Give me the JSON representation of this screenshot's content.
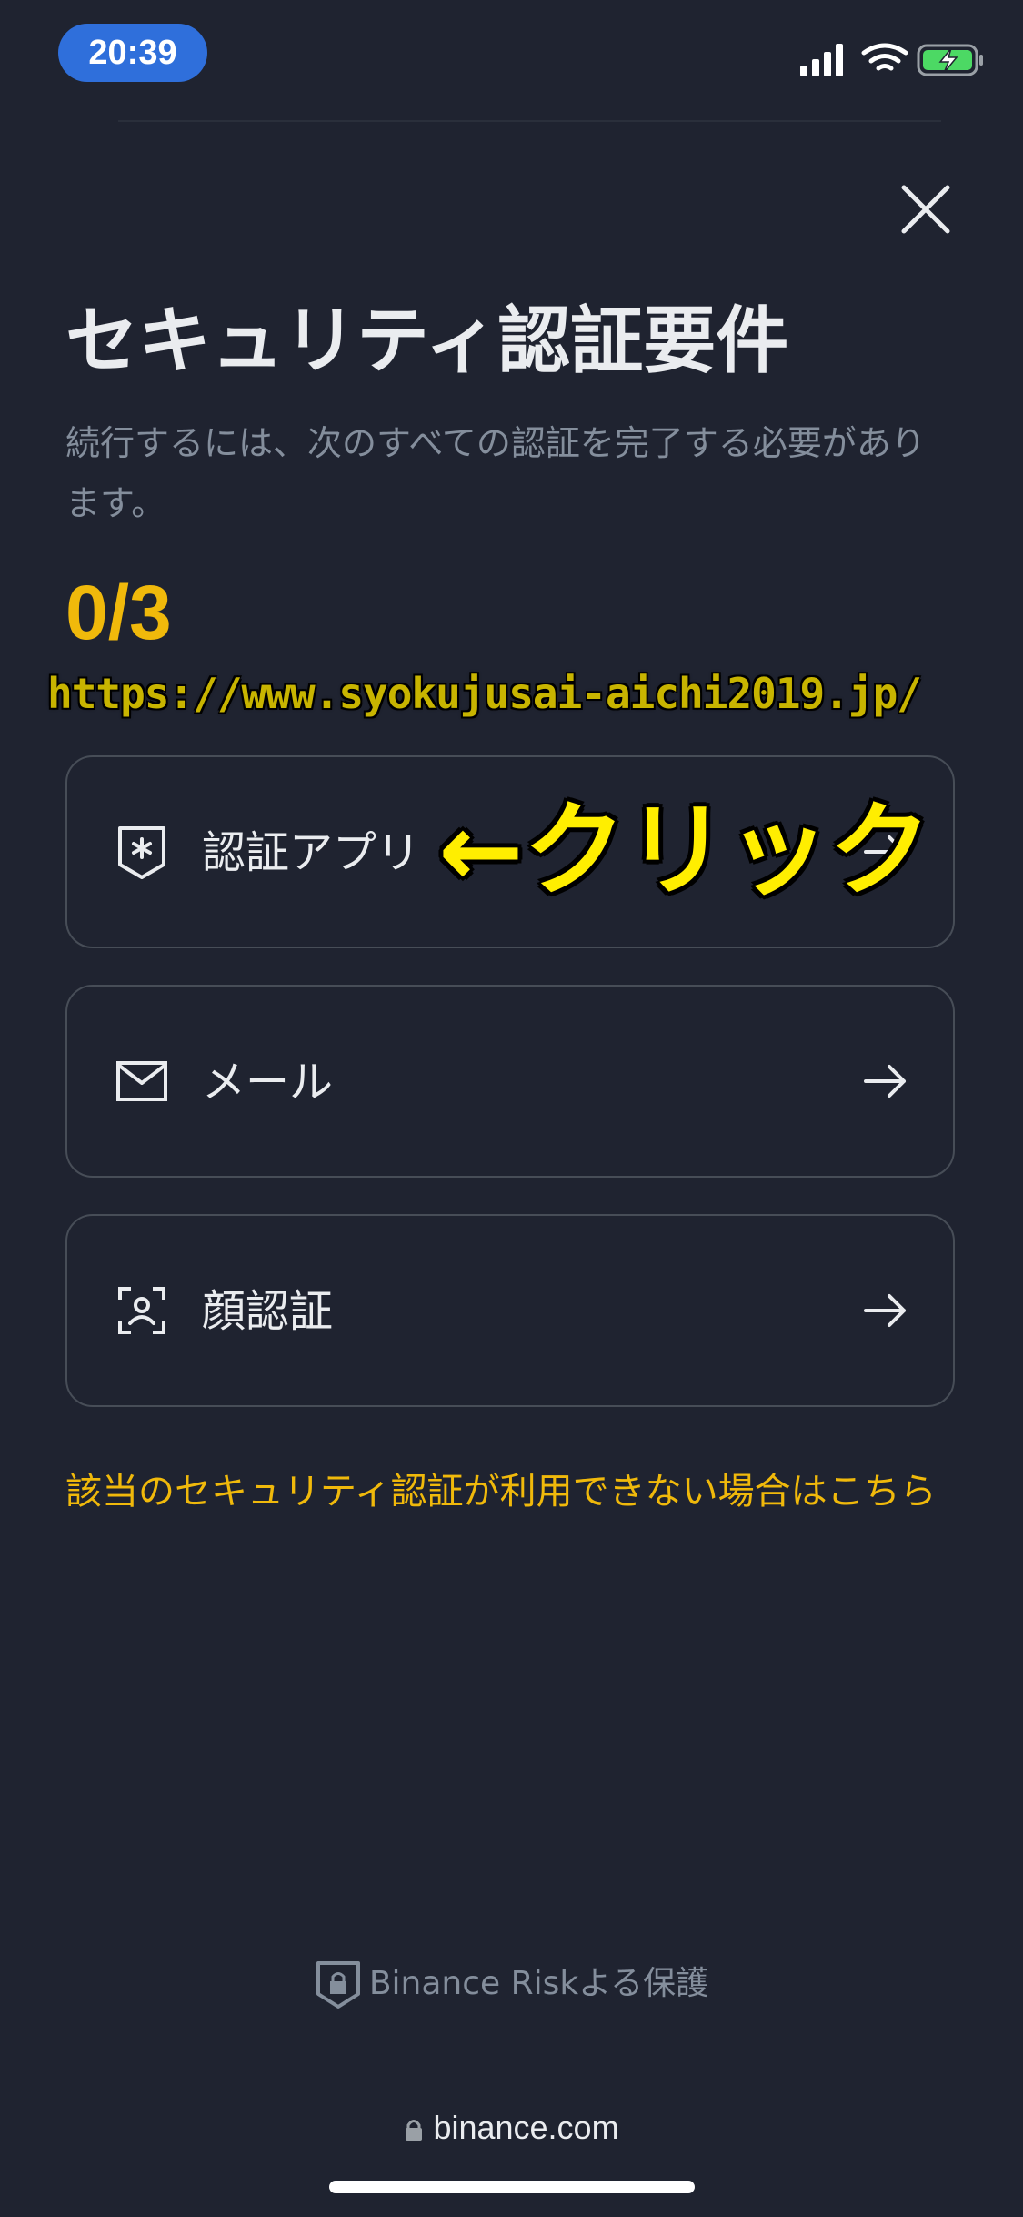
{
  "status_bar": {
    "time": "20:39"
  },
  "page": {
    "title": "セキュリティ認証要件",
    "subtitle": "続行するには、次のすべての認証を完了する必要があります。",
    "progress": "0/3"
  },
  "watermark": "https://www.syokujusai-aichi2019.jp/",
  "auth_methods": [
    {
      "label": "認証アプリ",
      "icon": "authenticator-shield-icon"
    },
    {
      "label": "メール",
      "icon": "mail-icon"
    },
    {
      "label": "顔認証",
      "icon": "face-scan-icon"
    }
  ],
  "annotation": "←クリック",
  "help_link": "該当のセキュリティ認証が利用できない場合はこちら",
  "footer": {
    "protection": "Binance Riskよる保護"
  },
  "browser": {
    "url": "binance.com"
  },
  "colors": {
    "background": "#1f2330",
    "accent": "#f0b90b",
    "annotation": "#ffee00"
  }
}
